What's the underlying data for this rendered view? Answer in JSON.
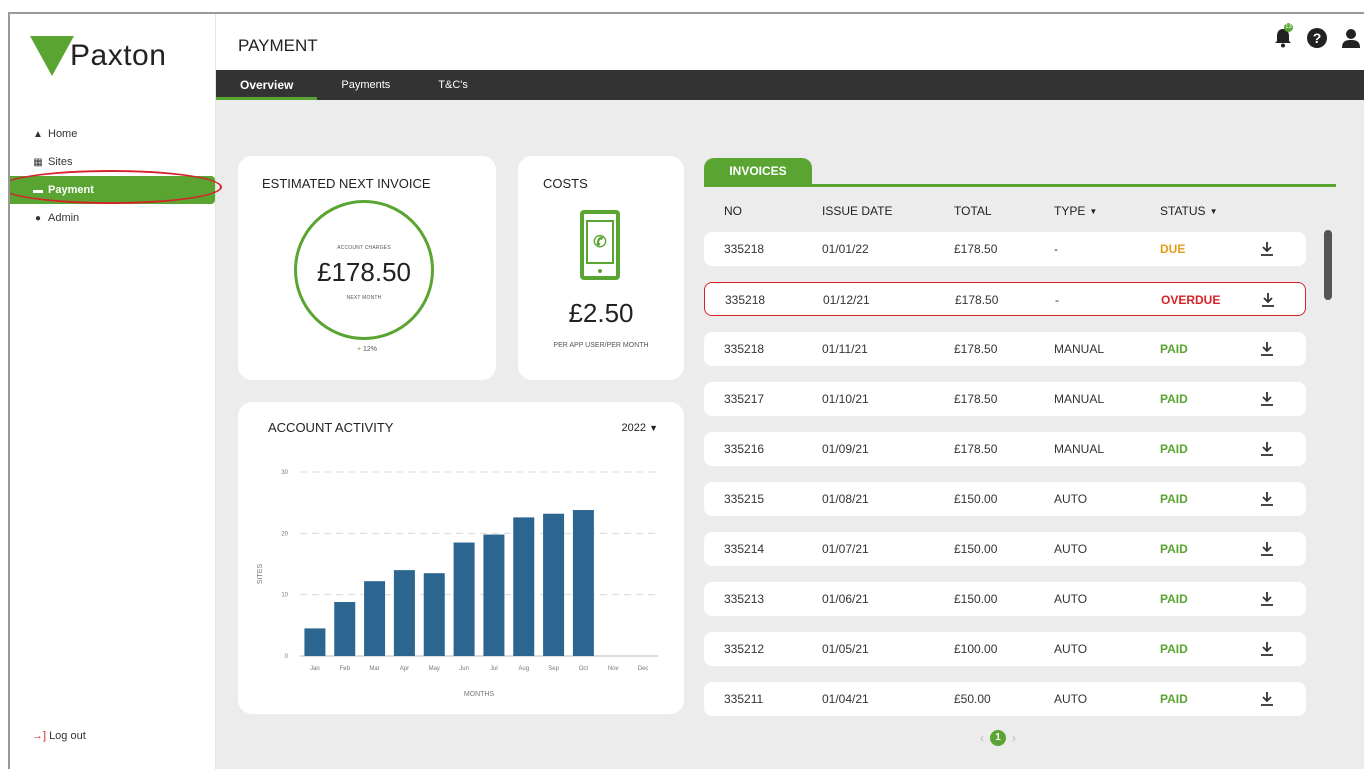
{
  "brand": {
    "name": "Paxton",
    "accent": "#5aa532"
  },
  "header": {
    "title": "PAYMENT",
    "bell_badge": "13"
  },
  "tabs": [
    {
      "label": "Overview"
    },
    {
      "label": "Payments"
    },
    {
      "label": "T&C's"
    }
  ],
  "sidebar": {
    "items": [
      {
        "label": "Home",
        "icon": "home-icon"
      },
      {
        "label": "Sites",
        "icon": "building-icon"
      },
      {
        "label": "Payment",
        "icon": "card-icon"
      },
      {
        "label": "Admin",
        "icon": "user-icon"
      }
    ],
    "logout": "Log out"
  },
  "estimate": {
    "title": "ESTIMATED NEXT INVOICE",
    "top_label": "ACCOUNT CHARGES",
    "amount": "£178.50",
    "bottom_label": "NEXT MONTH",
    "change_sign": "+",
    "change": "12%"
  },
  "costs": {
    "title": "COSTS",
    "amount": "£2.50",
    "unit": "PER APP USER/PER MONTH"
  },
  "activity": {
    "title": "ACCOUNT ACTIVITY",
    "year": "2022"
  },
  "chart_data": {
    "type": "bar",
    "title": "ACCOUNT ACTIVITY",
    "categories": [
      "Jan",
      "Feb",
      "Mar",
      "Apr",
      "May",
      "Jun",
      "Jul",
      "Aug",
      "Sep",
      "Oct",
      "Nov",
      "Dec"
    ],
    "values": [
      4.5,
      8.8,
      12.2,
      14,
      13.5,
      18.5,
      19.8,
      22.6,
      23.2,
      23.8,
      null,
      null
    ],
    "xlabel": "MONTHS",
    "ylabel": "SITES",
    "ylim": [
      0,
      30
    ],
    "yticks": [
      0,
      10,
      20,
      30
    ],
    "grid": true,
    "bar_color": "#2c6690"
  },
  "invoices": {
    "tab_label": "INVOICES",
    "columns": [
      "NO",
      "ISSUE DATE",
      "TOTAL",
      "TYPE",
      "STATUS"
    ],
    "rows": [
      {
        "no": "335218",
        "date": "01/01/22",
        "total": "£178.50",
        "type": "-",
        "status": "DUE"
      },
      {
        "no": "335218",
        "date": "01/12/21",
        "total": "£178.50",
        "type": "-",
        "status": "OVERDUE"
      },
      {
        "no": "335218",
        "date": "01/11/21",
        "total": "£178.50",
        "type": "MANUAL",
        "status": "PAID"
      },
      {
        "no": "335217",
        "date": "01/10/21",
        "total": "£178.50",
        "type": "MANUAL",
        "status": "PAID"
      },
      {
        "no": "335216",
        "date": "01/09/21",
        "total": "£178.50",
        "type": "MANUAL",
        "status": "PAID"
      },
      {
        "no": "335215",
        "date": "01/08/21",
        "total": "£150.00",
        "type": "AUTO",
        "status": "PAID"
      },
      {
        "no": "335214",
        "date": "01/07/21",
        "total": "£150.00",
        "type": "AUTO",
        "status": "PAID"
      },
      {
        "no": "335213",
        "date": "01/06/21",
        "total": "£150.00",
        "type": "AUTO",
        "status": "PAID"
      },
      {
        "no": "335212",
        "date": "01/05/21",
        "total": "£100.00",
        "type": "AUTO",
        "status": "PAID"
      },
      {
        "no": "335211",
        "date": "01/04/21",
        "total": "£50.00",
        "type": "AUTO",
        "status": "PAID"
      }
    ]
  },
  "pagination": {
    "current": "1"
  }
}
